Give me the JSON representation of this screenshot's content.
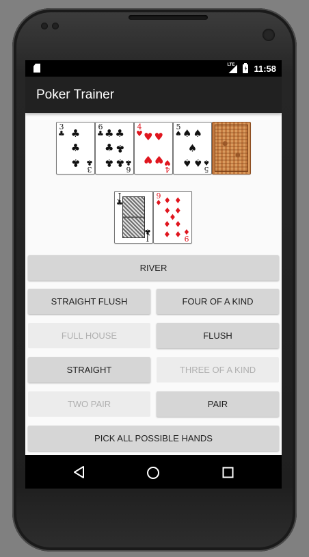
{
  "status_bar": {
    "time": "11:58",
    "network_label": "LTE",
    "icons": [
      "sd-card-icon",
      "lte-signal-icon",
      "battery-charging-icon"
    ]
  },
  "app": {
    "title": "Poker Trainer"
  },
  "board_cards": [
    {
      "rank": "3",
      "suit": "♣",
      "color": "black",
      "pips": 3
    },
    {
      "rank": "6",
      "suit": "♣",
      "color": "black",
      "pips": 6
    },
    {
      "rank": "4",
      "suit": "♥",
      "color": "red",
      "pips": 4
    },
    {
      "rank": "5",
      "suit": "♠",
      "color": "black",
      "pips": 5
    },
    {
      "rank": "",
      "suit": "",
      "color": "back",
      "face_down": true
    }
  ],
  "hole_cards": [
    {
      "rank": "J",
      "suit": "♣",
      "color": "black",
      "face_card": true
    },
    {
      "rank": "9",
      "suit": "♦",
      "color": "red",
      "pips": 9
    }
  ],
  "buttons": {
    "river": {
      "label": "RIVER",
      "enabled": true
    },
    "straight_flush": {
      "label": "STRAIGHT FLUSH",
      "enabled": true
    },
    "four_of_a_kind": {
      "label": "FOUR OF A KIND",
      "enabled": true
    },
    "full_house": {
      "label": "FULL HOUSE",
      "enabled": false
    },
    "flush": {
      "label": "FLUSH",
      "enabled": true
    },
    "straight": {
      "label": "STRAIGHT",
      "enabled": true
    },
    "three_of_a_kind": {
      "label": "THREE OF A KIND",
      "enabled": false
    },
    "two_pair": {
      "label": "TWO PAIR",
      "enabled": false
    },
    "pair": {
      "label": "PAIR",
      "enabled": true
    },
    "pick_all": {
      "label": "PICK ALL POSSIBLE HANDS",
      "enabled": true
    }
  },
  "colors": {
    "action_bar": "#212121",
    "button": "#d6d6d6",
    "button_disabled": "#ececec",
    "red_suit": "#e0161f"
  }
}
